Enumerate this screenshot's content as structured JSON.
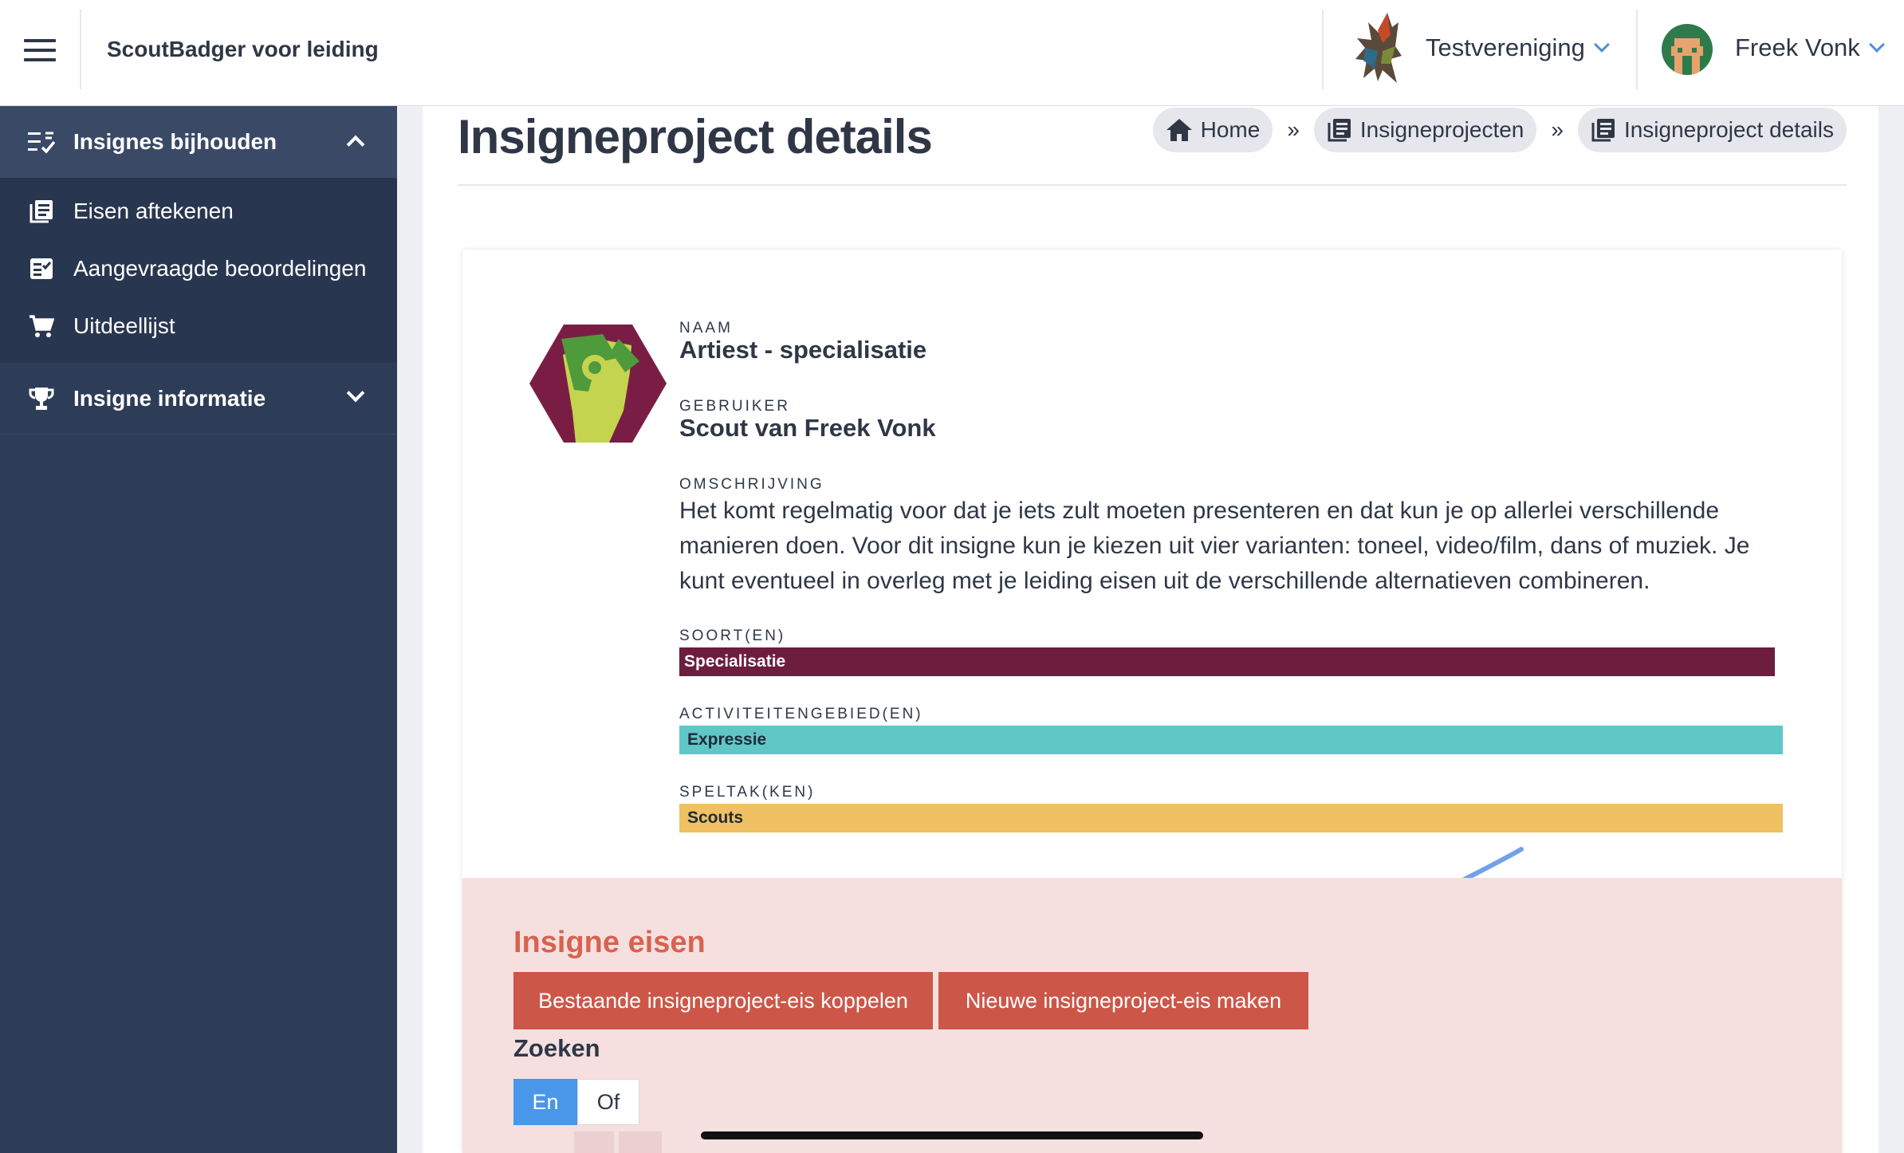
{
  "header": {
    "app_title": "ScoutBadger voor leiding",
    "club_name": "Testvereniging",
    "user_name": "Freek Vonk"
  },
  "sidebar": {
    "groups": [
      {
        "label": "Insignes bijhouden",
        "expanded": true,
        "items": [
          {
            "label": "Eisen aftekenen",
            "icon": "list-book-icon"
          },
          {
            "label": "Aangevraagde beoordelingen",
            "icon": "checklist-icon"
          },
          {
            "label": "Uitdeellijst",
            "icon": "cart-icon"
          }
        ]
      },
      {
        "label": "Insigne informatie",
        "expanded": false,
        "items": []
      }
    ]
  },
  "page": {
    "title": "Insigneproject details",
    "breadcrumb": [
      "Home",
      "Insigneprojecten",
      "Insigneproject details"
    ],
    "breadcrumb_separator": "»"
  },
  "details": {
    "naam_label": "NAAM",
    "naam": "Artiest - specialisatie",
    "gebruiker_label": "GEBRUIKER",
    "gebruiker": "Scout van Freek Vonk",
    "omschrijving_label": "OMSCHRIJVING",
    "omschrijving": "Het komt regelmatig voor dat je iets zult moeten presenteren en dat kun je op allerlei verschillende manieren doen. Voor dit insigne kun je kiezen uit vier varianten: toneel, video/film, dans of muziek. Je kunt eventueel in overleg met je leiding eisen uit de verschillende alternatieven combineren.",
    "soort_label": "SOORT(EN)",
    "soort": "Specialisatie",
    "activiteiten_label": "ACTIVITEITENGEBIED(EN)",
    "activiteiten": "Expressie",
    "speltak_label": "SPELTAK(KEN)",
    "speltak": "Scouts"
  },
  "eisen": {
    "title": "Insigne eisen",
    "btn_koppelen": "Bestaande insigneproject-eis koppelen",
    "btn_maken": "Nieuwe insigneproject-eis maken",
    "zoeken": "Zoeken",
    "toggle_en": "En",
    "toggle_of": "Of"
  },
  "colors": {
    "sidebar_bg": "#2e3d57",
    "soort_bar": "#6d1d3e",
    "activiteiten_bar": "#61c6c6",
    "speltak_bar": "#f0c162",
    "eisen_bg": "#f5e0df",
    "accent_red": "#cc5749",
    "toggle_active": "#4a96e8"
  }
}
